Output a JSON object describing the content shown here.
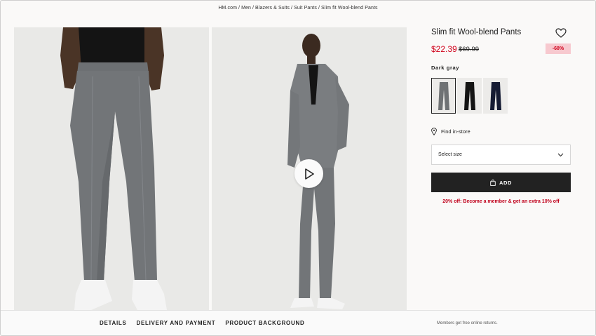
{
  "breadcrumb": [
    "HM.com",
    "Men",
    "Blazers & Suits",
    "Suit Pants",
    "Slim fit Wool-blend Pants"
  ],
  "breadcrumb_separator": "/",
  "product": {
    "title": "Slim fit Wool-blend Pants",
    "price": "$22.39",
    "old_price": "$69.99",
    "discount": "-68%",
    "color_label": "Dark gray",
    "swatches": [
      {
        "name": "Dark gray",
        "color": "#6f7274",
        "selected": true
      },
      {
        "name": "Black",
        "color": "#141414",
        "selected": false
      },
      {
        "name": "Dark blue",
        "color": "#151b33",
        "selected": false
      }
    ]
  },
  "find_in_store": "Find in-store",
  "size_select": {
    "placeholder": "Select size"
  },
  "add_button": "ADD",
  "member_offer": "20% off: Become a member & get an extra 10% off",
  "footer": {
    "tabs": [
      "DETAILS",
      "DELIVERY AND PAYMENT",
      "PRODUCT BACKGROUND"
    ],
    "note": "Members get free online returns."
  },
  "colors": {
    "sale_red": "#d0021b",
    "discount_bg": "#f7c9cf",
    "add_button_bg": "#222222",
    "pants_gray": "#6f7274"
  },
  "icons": [
    "heart-icon",
    "play-icon",
    "location-pin-icon",
    "chevron-down-icon",
    "bag-icon"
  ]
}
